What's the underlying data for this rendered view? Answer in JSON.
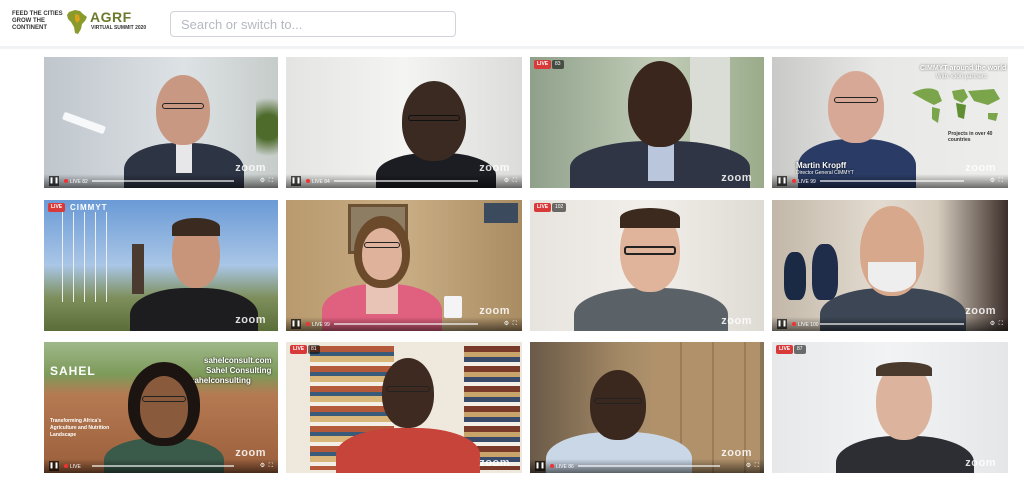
{
  "header": {
    "logo_left": "FEED THE CITIES GROW THE CONTINENT",
    "logo_title": "AGRF",
    "logo_subtitle": "VIRTUAL SUMMIT 2020",
    "search_placeholder": "Search or switch to..."
  },
  "tiles": [
    {
      "zoom": "zoom",
      "live": "LIVE",
      "viewers": "82"
    },
    {
      "zoom": "zoom",
      "live": "LIVE",
      "viewers": "84"
    },
    {
      "zoom": "zoom",
      "live": "LIVE",
      "viewers": "83"
    },
    {
      "zoom": "zoom",
      "live": "LIVE",
      "viewers": "99",
      "overlay_title": "CIMMYT around the world",
      "overlay_sub": "With >300 partners",
      "overlay_projects": "Projects in over 40 countries",
      "name": "Martin Kropff",
      "role": "Director General CIMMYT"
    },
    {
      "zoom": "zoom",
      "live": "LIVE",
      "viewers": "",
      "brand": "CIMMYT"
    },
    {
      "zoom": "zoom",
      "live": "LIVE",
      "viewers": "99"
    },
    {
      "zoom": "zoom",
      "live": "LIVE",
      "viewers": "102"
    },
    {
      "zoom": "zoom",
      "live": "LIVE",
      "viewers": "100"
    },
    {
      "zoom": "zoom",
      "live": "LIVE",
      "viewers": "",
      "brand": "SAHEL",
      "site": "sahelconsult.com",
      "company": "Sahel Consulting",
      "handle": "sahelconsulting",
      "tagline": "Transforming Africa's Agriculture and Nutrition Landscape"
    },
    {
      "zoom": "zoom",
      "live": "LIVE",
      "viewers": "81"
    },
    {
      "zoom": "zoom",
      "live": "LIVE",
      "viewers": "86"
    },
    {
      "zoom": "zoom",
      "live": "LIVE",
      "viewers": "87"
    }
  ]
}
